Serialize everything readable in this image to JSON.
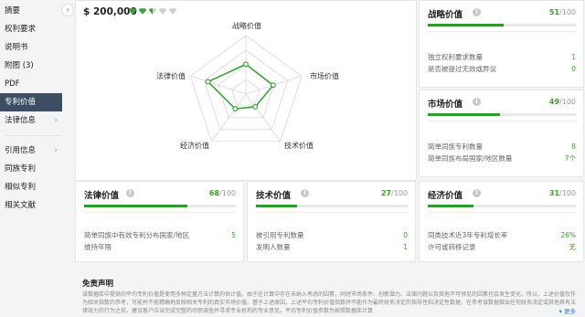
{
  "sidebar": {
    "items": [
      {
        "label": "摘要",
        "active": false,
        "chevron": false
      },
      {
        "label": "权利要求",
        "active": false,
        "chevron": false
      },
      {
        "label": "说明书",
        "active": false,
        "chevron": false
      },
      {
        "label": "附图 (3)",
        "active": false,
        "chevron": false
      },
      {
        "label": "PDF",
        "active": false,
        "chevron": false
      },
      {
        "label": "专利价值",
        "active": true,
        "chevron": false
      },
      {
        "label": "法律信息",
        "active": false,
        "chevron": true
      }
    ],
    "items2": [
      {
        "label": "引用信息",
        "chevron": true
      },
      {
        "label": "同族专利",
        "chevron": false
      },
      {
        "label": "相似专利",
        "chevron": false
      },
      {
        "label": "相关文献",
        "chevron": false
      }
    ],
    "collapse_glyph": "‹"
  },
  "valuation": {
    "price": "$ 200,000",
    "diamonds": [
      "full",
      "full",
      "half",
      "empty",
      "empty"
    ],
    "diamond_colors": {
      "full": "#3fa33a",
      "empty": "#cfcfcf"
    }
  },
  "chart_data": {
    "type": "radar",
    "axes": [
      "战略价值",
      "市场价值",
      "技术价值",
      "经济价值",
      "法律价值"
    ],
    "max": 100,
    "values": [
      51,
      49,
      27,
      31,
      68
    ],
    "color": "#3fa33a"
  },
  "cards": {
    "strategic": {
      "title": "战略价值",
      "score": "51",
      "denom": "/100",
      "percent": 51,
      "rows": [
        {
          "label": "独立权利要求数量",
          "value": "1"
        },
        {
          "label": "是否被提过无效或异议",
          "value": "0"
        }
      ]
    },
    "market": {
      "title": "市场价值",
      "score": "49",
      "denom": "/100",
      "percent": 49,
      "rows": [
        {
          "label": "简单同族专利数量",
          "value": "8"
        },
        {
          "label": "简单同族布局国家/地区数量",
          "value": "7个"
        }
      ]
    },
    "legal": {
      "title": "法律价值",
      "score": "68",
      "denom": "/100",
      "percent": 68,
      "rows": [
        {
          "label": "简单同族中有效专利分布国家/地区",
          "value": "5"
        },
        {
          "label": "维持年限",
          "value": ""
        }
      ]
    },
    "technical": {
      "title": "技术价值",
      "score": "27",
      "denom": "/100",
      "percent": 27,
      "rows": [
        {
          "label": "被引用专利数量",
          "value": "0"
        },
        {
          "label": "发明人数量",
          "value": "1"
        }
      ]
    },
    "economic": {
      "title": "经济价值",
      "score": "31",
      "denom": "/100",
      "percent": 31,
      "rows": [
        {
          "label": "同类技术近3年专利增长率",
          "value": "26%"
        },
        {
          "label": "许可或转移记录",
          "value": "无"
        }
      ]
    }
  },
  "disclaimer": {
    "title": "免责声明",
    "text": "该数据库中提供的平均专利价值是使用多种定量方法计算的估计值。由于在计算中存在未纳入考虑的因素，同时市场条件、创新潜力、法律问题以及其他不可预见的因素也会发生变化，所以，上述价值仅作为相关指数的参考，可能并不能精确地反映相关专利的真实市场价值。基于上述原因，上述平均专利价值指数并不能作为最终财务决定的指导性和决定性数据，在参考该数据做出任何财务决定或其他具有法律效力的行为之前，建议客户应当完成完整的尽职调查并寻求专业机构的专业意见。平均专利价值参数为按照数据库计算",
    "more": "更多"
  }
}
